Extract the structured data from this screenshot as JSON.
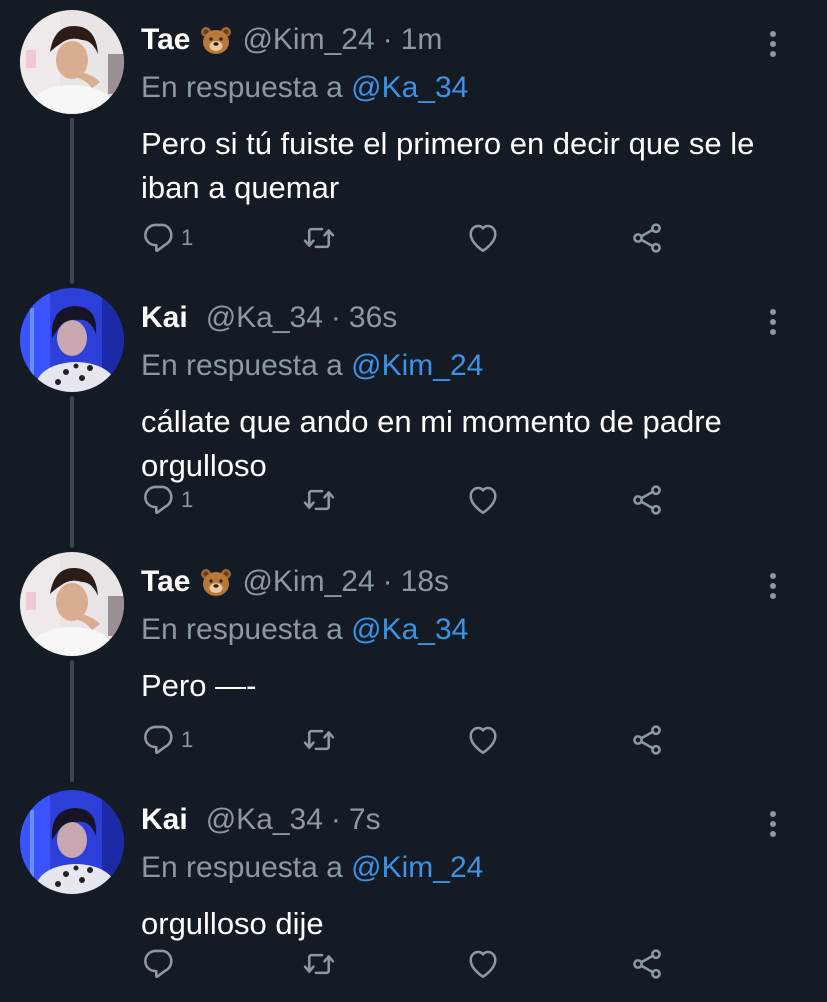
{
  "colors": {
    "background": "#151b24",
    "thread_line": "#3d4652",
    "secondary_text": "#8b98a5",
    "link": "#3a93e6",
    "icon": "#8b98a5"
  },
  "reply_prefix": "En respuesta a",
  "tweets": [
    {
      "display_name": "Tae",
      "emoji": "bear-face-icon",
      "handle": "@Kim_24",
      "dot": "·",
      "time": "1m",
      "reply_to": "@Ka_34",
      "text": "Pero si tú fuiste el primero en decir que se le iban a quemar",
      "reply_count": "1"
    },
    {
      "display_name": "Kai",
      "emoji": "",
      "handle": "@Ka_34",
      "dot": "·",
      "time": "36s",
      "reply_to": "@Kim_24",
      "text": "cállate que ando en mi momento de padre orgulloso",
      "reply_count": "1"
    },
    {
      "display_name": "Tae",
      "emoji": "bear-face-icon",
      "handle": "@Kim_24",
      "dot": "·",
      "time": "18s",
      "reply_to": "@Ka_34",
      "text": "Pero —-",
      "reply_count": "1"
    },
    {
      "display_name": "Kai",
      "emoji": "",
      "handle": "@Ka_34",
      "dot": "·",
      "time": "7s",
      "reply_to": "@Kim_24",
      "text": "orgulloso dije",
      "reply_count": ""
    }
  ]
}
